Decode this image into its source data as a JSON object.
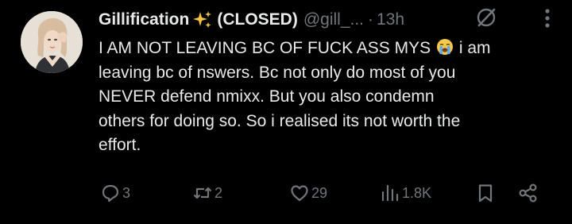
{
  "tweet": {
    "display_name": "Gillification",
    "status_tag": "(CLOSED)",
    "handle": "@gill_...",
    "separator": "·",
    "time": "13h",
    "lines": [
      "I AM NOT LEAVING BC OF FUCK ASS MYS",
      "i am",
      "leaving bc of nswers. Bc not only do most of you",
      "NEVER defend nmixx. But you also condemn",
      "others for doing so. So i realised its not worth the",
      "effort."
    ],
    "inline_emoji": "loudly-crying-face-emoji",
    "name_emoji": "sparkles-emoji"
  },
  "actions": {
    "replies": "3",
    "reposts": "2",
    "likes": "29",
    "views": "1.8K"
  },
  "icons": {
    "reply": "reply-icon",
    "repost": "repost-icon",
    "like": "heart-icon",
    "views": "views-icon",
    "bookmark": "bookmark-icon",
    "share": "share-icon",
    "grok": "grok-icon",
    "more": "more-icon"
  },
  "colors": {
    "background": "#000000",
    "text": "#e7e9ea",
    "muted": "#71767b",
    "sparkle": "#f6c343"
  }
}
